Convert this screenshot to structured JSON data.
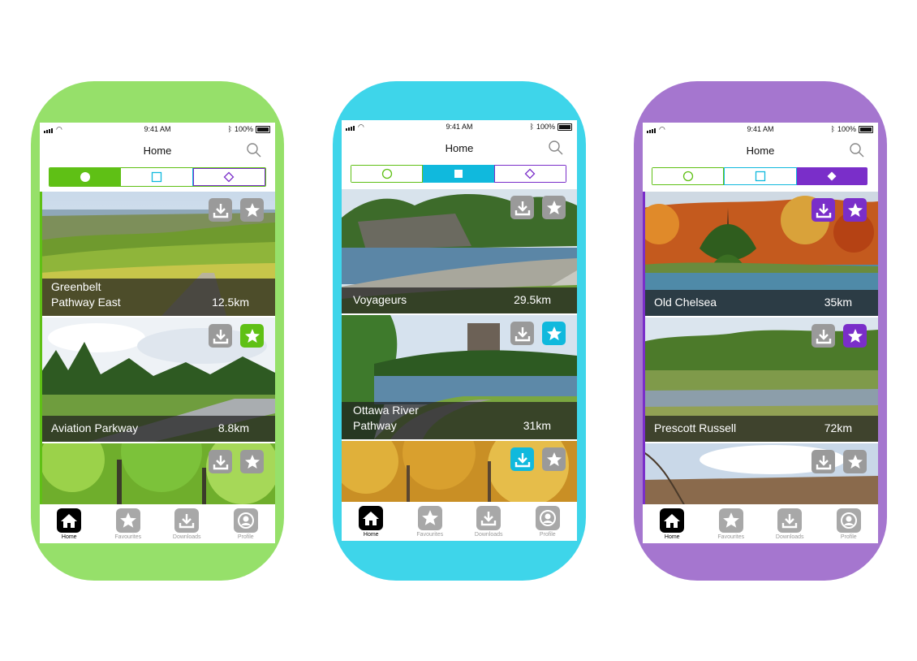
{
  "phones": [
    {
      "theme": "green",
      "accent": "#5fc015",
      "frame_color": "#96e06a",
      "status": {
        "time": "9:41 AM",
        "battery": "100%"
      },
      "title": "Home",
      "segments": [
        "circle-icon",
        "square-icon",
        "diamond-icon"
      ],
      "selected_segment": 0,
      "cards": [
        {
          "name_line1": "Greenbelt",
          "name_line2": "Pathway East",
          "distance": "12.5km",
          "downloaded": false,
          "favourite": false
        },
        {
          "name_line1": "Aviation Parkway",
          "name_line2": "",
          "distance": "8.8km",
          "downloaded": false,
          "favourite": true
        },
        {
          "name_line1": "",
          "name_line2": "",
          "distance": "",
          "downloaded": false,
          "favourite": false
        }
      ],
      "tabs": [
        "Home",
        "Favourites",
        "Downloads",
        "Profile"
      ]
    },
    {
      "theme": "cyan",
      "accent": "#10b9dd",
      "frame_color": "#3ed5ea",
      "status": {
        "time": "9:41 AM",
        "battery": "100%"
      },
      "title": "Home",
      "segments": [
        "circle-icon",
        "square-icon",
        "diamond-icon"
      ],
      "selected_segment": 1,
      "cards": [
        {
          "name_line1": "Voyageurs",
          "name_line2": "",
          "distance": "29.5km",
          "downloaded": false,
          "favourite": false
        },
        {
          "name_line1": "Ottawa River",
          "name_line2": "Pathway",
          "distance": "31km",
          "downloaded": false,
          "favourite": true
        },
        {
          "name_line1": "",
          "name_line2": "",
          "distance": "",
          "downloaded": true,
          "favourite": false
        }
      ],
      "tabs": [
        "Home",
        "Favourites",
        "Downloads",
        "Profile"
      ]
    },
    {
      "theme": "purple",
      "accent": "#7a2ec9",
      "frame_color": "#a576cf",
      "status": {
        "time": "9:41 AM",
        "battery": "100%"
      },
      "title": "Home",
      "segments": [
        "circle-icon",
        "square-icon",
        "diamond-icon"
      ],
      "selected_segment": 2,
      "cards": [
        {
          "name_line1": "Old Chelsea",
          "name_line2": "",
          "distance": "35km",
          "downloaded": true,
          "favourite": true
        },
        {
          "name_line1": "Prescott Russell",
          "name_line2": "",
          "distance": "72km",
          "downloaded": false,
          "favourite": true
        },
        {
          "name_line1": "",
          "name_line2": "",
          "distance": "",
          "downloaded": false,
          "favourite": false
        }
      ],
      "tabs": [
        "Home",
        "Favourites",
        "Downloads",
        "Profile"
      ]
    }
  ]
}
